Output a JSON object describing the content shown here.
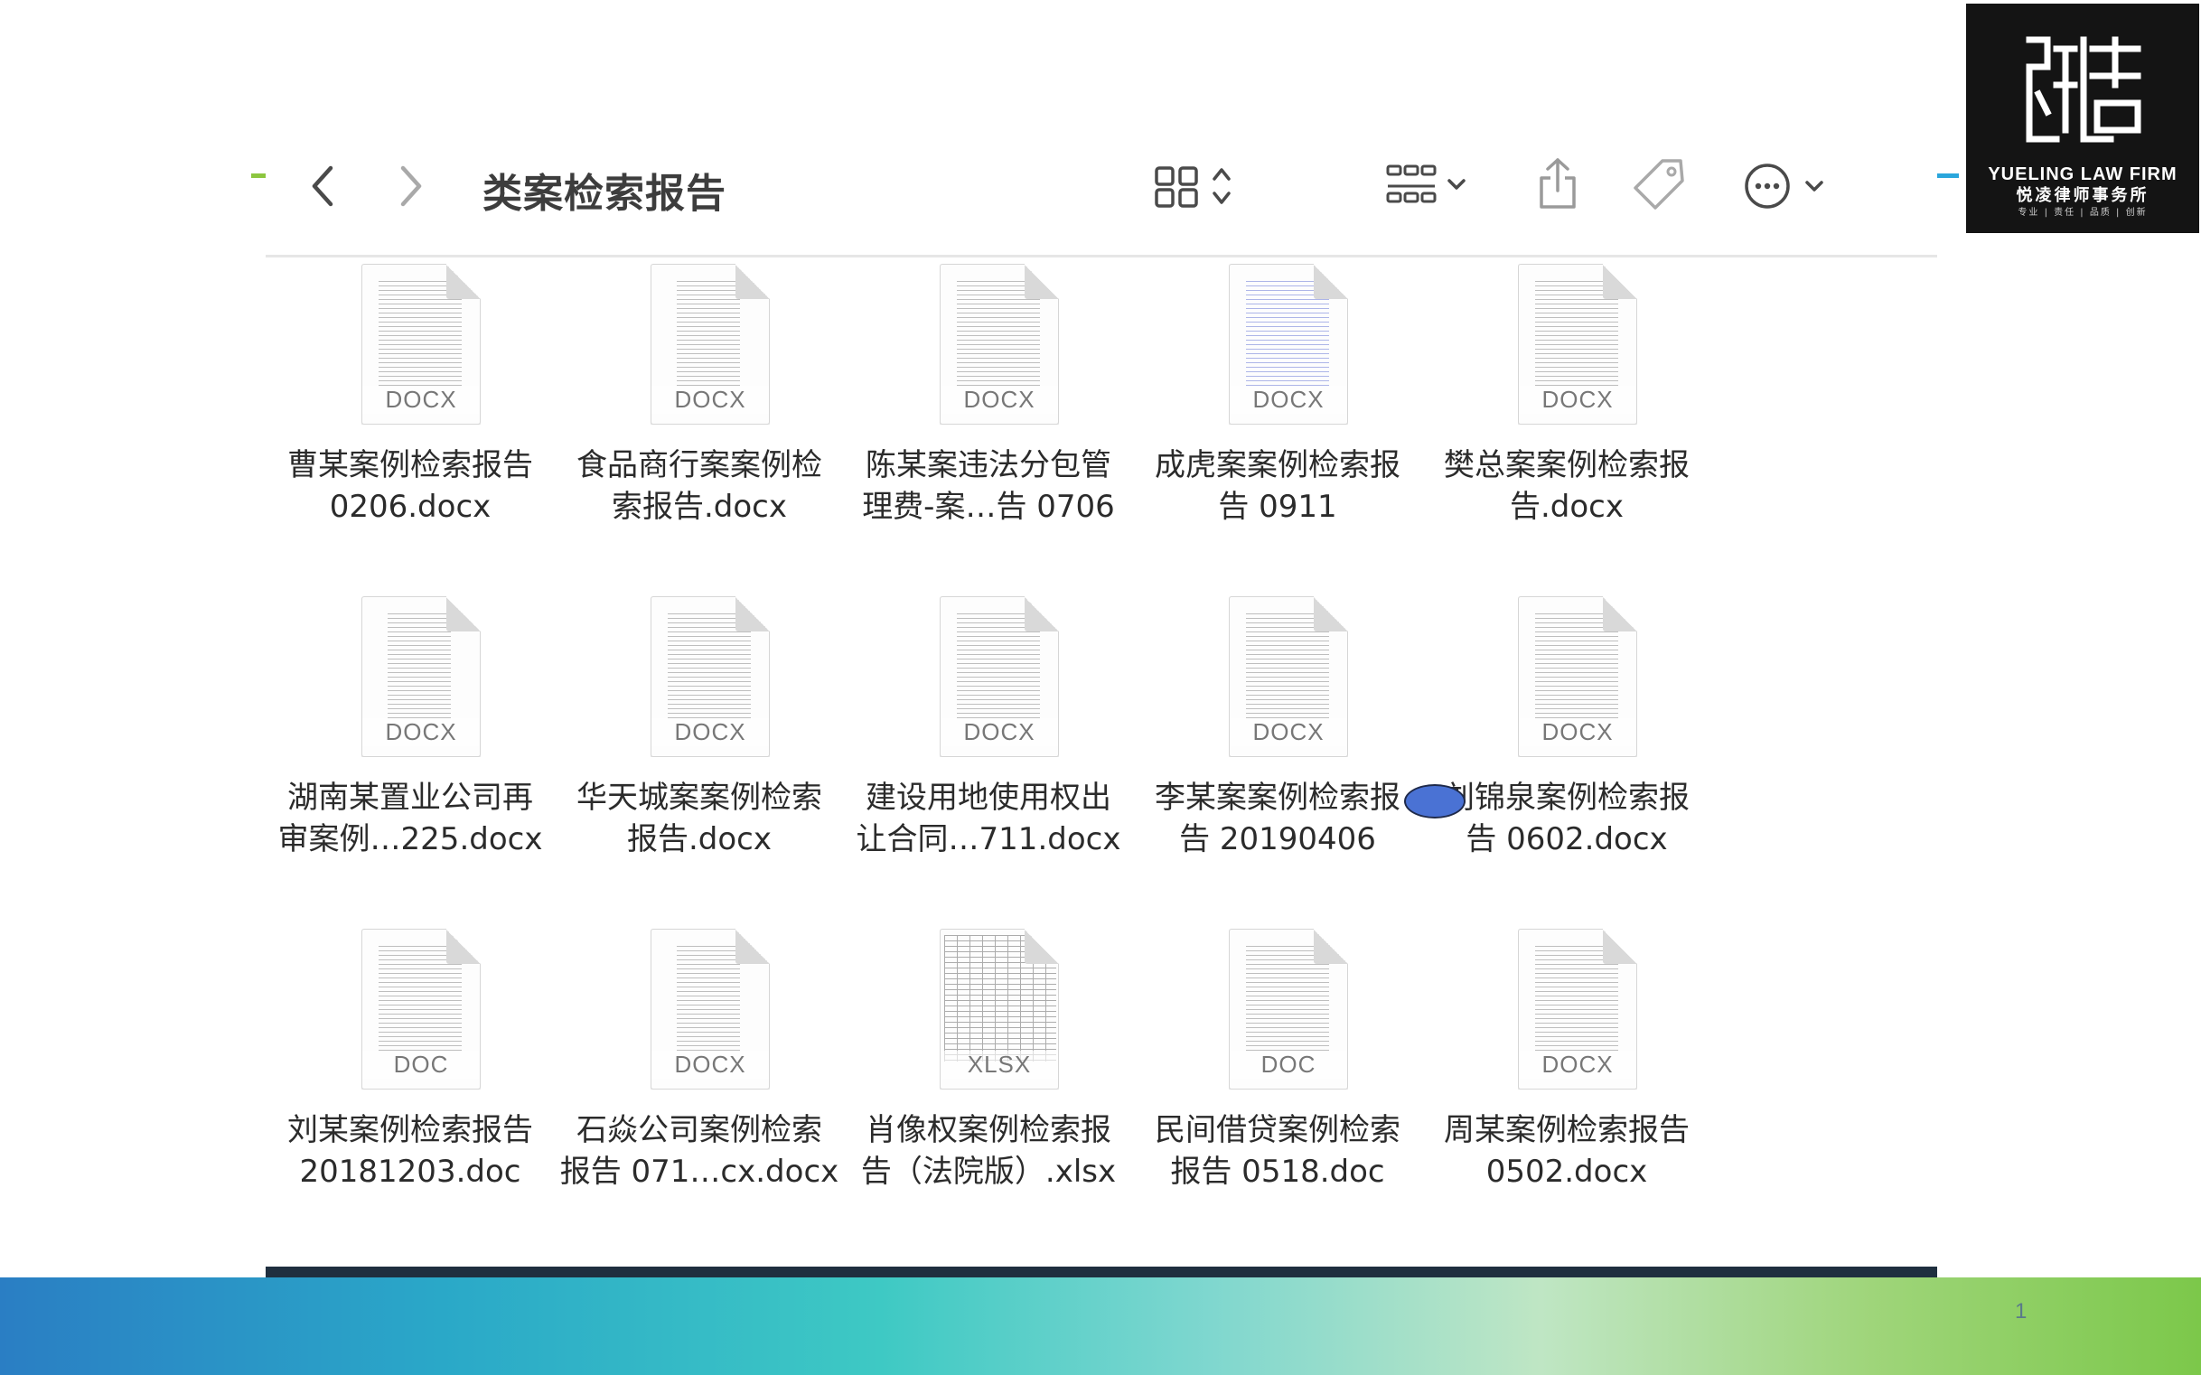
{
  "toolbar": {
    "title": "类案检索报告",
    "icons": [
      "back-chevron-icon",
      "forward-chevron-icon",
      "icon-view-grid-icon",
      "group-by-icon",
      "share-icon",
      "tag-icon",
      "more-actions-icon"
    ]
  },
  "logo": {
    "en": "YUELING LAW FIRM",
    "cn": "悦凌律师事务所",
    "tagline": "专业 | 责任 | 品质 | 创新"
  },
  "files": [
    {
      "line1": "曹某案例检索报告",
      "line2": "0206.docx",
      "ext": "DOCX"
    },
    {
      "line1": "食品商行案案例检",
      "line2": "索报告.docx",
      "ext": "DOCX"
    },
    {
      "line1": "陈某案违法分包管",
      "line2": "理费-案…告 0706",
      "ext": "DOCX"
    },
    {
      "line1": "成虎案案例检索报",
      "line2": "告 0911",
      "ext": "DOCX"
    },
    {
      "line1": "樊总案案例检索报",
      "line2": "告.docx",
      "ext": "DOCX"
    },
    {
      "line1": "湖南某置业公司再",
      "line2": "审案例…225.docx",
      "ext": "DOCX"
    },
    {
      "line1": "华天城案案例检索",
      "line2": "报告.docx",
      "ext": "DOCX"
    },
    {
      "line1": "建设用地使用权出",
      "line2": "让合同…711.docx",
      "ext": "DOCX"
    },
    {
      "line1": "李某案案例检索报",
      "line2": "告 20190406",
      "ext": "DOCX"
    },
    {
      "line1": "刘锦泉案例检索报",
      "line2": "告 0602.docx",
      "ext": "DOCX"
    },
    {
      "line1": "刘某案例检索报告",
      "line2": "20181203.doc",
      "ext": "DOC"
    },
    {
      "line1": "石焱公司案例检索",
      "line2": "报告 071…cx.docx",
      "ext": "DOCX"
    },
    {
      "line1": "肖像权案例检索报",
      "line2": "告（法院版）.xlsx",
      "ext": "XLSX"
    },
    {
      "line1": "民间借贷案例检索",
      "line2": "报告 0518.doc",
      "ext": "DOC"
    },
    {
      "line1": "周某案例检索报告",
      "line2": "0502.docx",
      "ext": "DOCX"
    }
  ],
  "page_number": "1",
  "colors": {
    "accent_green": "#8cc63f",
    "accent_blue": "#2aa6dc",
    "cursor": "#4a72d4",
    "logo_bg": "#141414"
  }
}
